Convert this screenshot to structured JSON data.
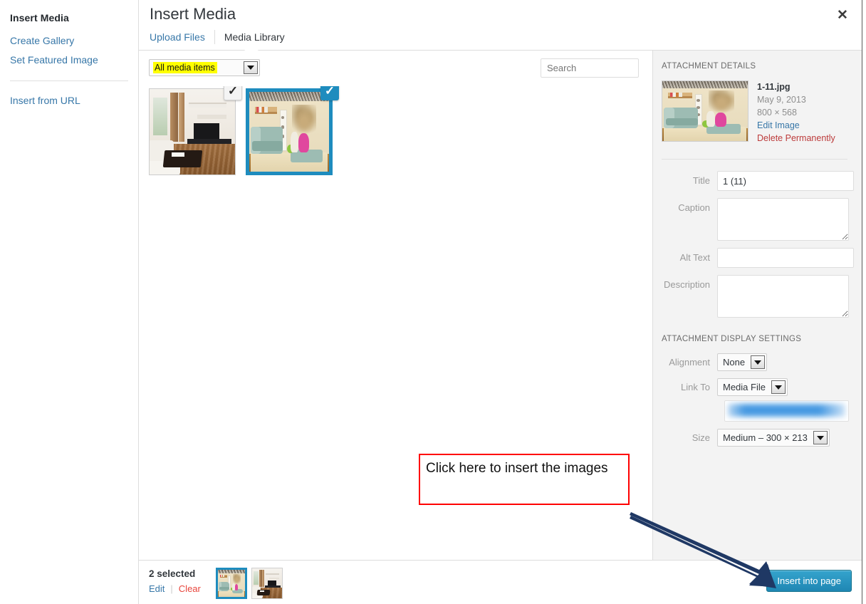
{
  "sidebar": {
    "title": "Insert Media",
    "items": [
      {
        "label": "Create Gallery"
      },
      {
        "label": "Set Featured Image"
      },
      {
        "label": "Insert from URL"
      }
    ]
  },
  "modal": {
    "title": "Insert Media",
    "close_icon": "close-icon",
    "tabs": [
      {
        "label": "Upload Files",
        "active": false
      },
      {
        "label": "Media Library",
        "active": true
      }
    ]
  },
  "toolbar": {
    "filter_value": "All media items",
    "filter_highlight_color": "#ffff00",
    "search_placeholder": "Search",
    "search_value": ""
  },
  "grid": {
    "items": [
      {
        "name": "media-item-1",
        "selected": false,
        "check_icon": "checkmark-icon"
      },
      {
        "name": "media-item-2",
        "selected": true,
        "check_icon": "checkmark-icon"
      }
    ]
  },
  "attachment_details": {
    "heading": "ATTACHMENT DETAILS",
    "filename": "1-11.jpg",
    "date": "May 9, 2013",
    "dimensions": "800 × 568",
    "edit_link": "Edit Image",
    "delete_link": "Delete Permanently",
    "fields": {
      "title_label": "Title",
      "title_value": "1 (11)",
      "caption_label": "Caption",
      "caption_value": "",
      "alt_label": "Alt Text",
      "alt_value": "",
      "description_label": "Description",
      "description_value": ""
    }
  },
  "display_settings": {
    "heading": "ATTACHMENT DISPLAY SETTINGS",
    "alignment_label": "Alignment",
    "alignment_value": "None",
    "link_to_label": "Link To",
    "link_to_value": "Media File",
    "url_value": "",
    "size_label": "Size",
    "size_value": "Medium – 300 × 213"
  },
  "footer": {
    "selected_count": "2 selected",
    "edit_label": "Edit",
    "separator": "|",
    "clear_label": "Clear",
    "insert_button": "Insert into page"
  },
  "annotation": {
    "callout_text": "Click here to insert the images",
    "callout_border_color": "#ff0000",
    "arrow_color": "#1f3864"
  }
}
